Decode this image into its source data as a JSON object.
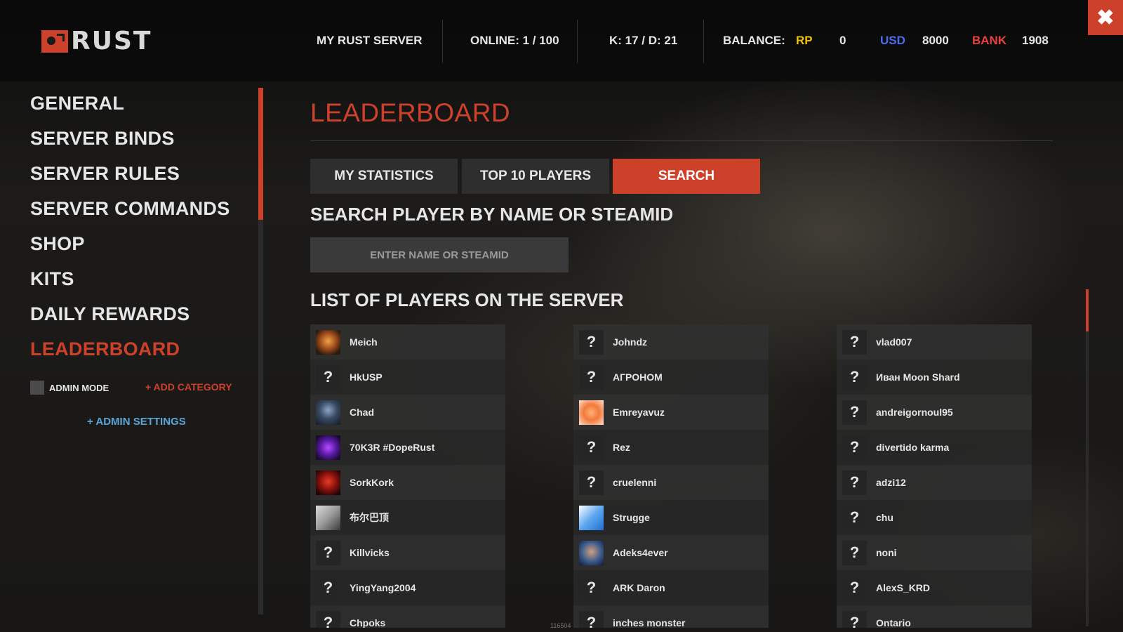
{
  "logo": {
    "text": "RUST"
  },
  "topbar": {
    "server_name": "MY RUST SERVER",
    "online": "ONLINE: 1 / 100",
    "kd": "K: 17  / D: 21",
    "balance_label": "BALANCE:",
    "rp_label": "RP",
    "rp_value": "0",
    "usd_label": "USD",
    "usd_value": "8000",
    "bank_label": "BANK",
    "bank_value": "1908",
    "close": "✖"
  },
  "colors": {
    "accent": "#cd412b",
    "rp": "#f2c200",
    "usd": "#4a6cf0",
    "bank": "#e8413a",
    "admin_link": "#5aa6d9"
  },
  "sidebar": {
    "items": [
      {
        "label": "GENERAL",
        "active": false
      },
      {
        "label": "SERVER BINDS",
        "active": false
      },
      {
        "label": "SERVER RULES",
        "active": false
      },
      {
        "label": "SERVER COMMANDS",
        "active": false
      },
      {
        "label": "SHOP",
        "active": false
      },
      {
        "label": "KITS",
        "active": false
      },
      {
        "label": "DAILY REWARDS",
        "active": false
      },
      {
        "label": "LEADERBOARD",
        "active": true
      }
    ],
    "admin_mode": "ADMIN MODE",
    "add_category": "+ ADD CATEGORY",
    "admin_settings": "+ ADMIN SETTINGS"
  },
  "main": {
    "title": "LEADERBOARD",
    "tabs": [
      {
        "label": "MY STATISTICS",
        "active": false
      },
      {
        "label": "TOP 10 PLAYERS",
        "active": false
      },
      {
        "label": "SEARCH",
        "active": true
      }
    ],
    "search_heading": "SEARCH PLAYER BY NAME OR STEAMID",
    "search_placeholder": "ENTER NAME OR STEAMID",
    "list_heading": "LIST OF PLAYERS ON THE SERVER",
    "footer_code": "116504"
  },
  "players": [
    [
      {
        "name": "Meich",
        "avatar": "img1"
      },
      {
        "name": "HkUSP",
        "avatar": "q"
      },
      {
        "name": "Chad",
        "avatar": "img2"
      },
      {
        "name": "70K3R #DopeRust",
        "avatar": "img3"
      },
      {
        "name": "SorkKork",
        "avatar": "img4"
      },
      {
        "name": "布尔巴顶",
        "avatar": "img5"
      },
      {
        "name": "Killvicks",
        "avatar": "q"
      },
      {
        "name": "YingYang2004",
        "avatar": "q"
      },
      {
        "name": "Chpoks",
        "avatar": "q"
      }
    ],
    [
      {
        "name": "Johndz",
        "avatar": "q"
      },
      {
        "name": "АГРОНОМ",
        "avatar": "q"
      },
      {
        "name": "Emreyavuz",
        "avatar": "img6"
      },
      {
        "name": "Rez",
        "avatar": "q"
      },
      {
        "name": "cruelenni",
        "avatar": "q"
      },
      {
        "name": "Strugge",
        "avatar": "img7"
      },
      {
        "name": "Adeks4ever",
        "avatar": "img8"
      },
      {
        "name": "ARK Daron",
        "avatar": "q"
      },
      {
        "name": "inches monster",
        "avatar": "q"
      }
    ],
    [
      {
        "name": "vlad007",
        "avatar": "q"
      },
      {
        "name": "Иван Moon Shard",
        "avatar": "q"
      },
      {
        "name": "andreigornoul95",
        "avatar": "q"
      },
      {
        "name": "divertido karma",
        "avatar": "q"
      },
      {
        "name": "adzi12",
        "avatar": "q"
      },
      {
        "name": "chu",
        "avatar": "q"
      },
      {
        "name": "noni",
        "avatar": "q"
      },
      {
        "name": "AlexS_KRD",
        "avatar": "q"
      },
      {
        "name": "Ontario",
        "avatar": "q"
      }
    ]
  ],
  "unknown_avatar_glyph": "?"
}
